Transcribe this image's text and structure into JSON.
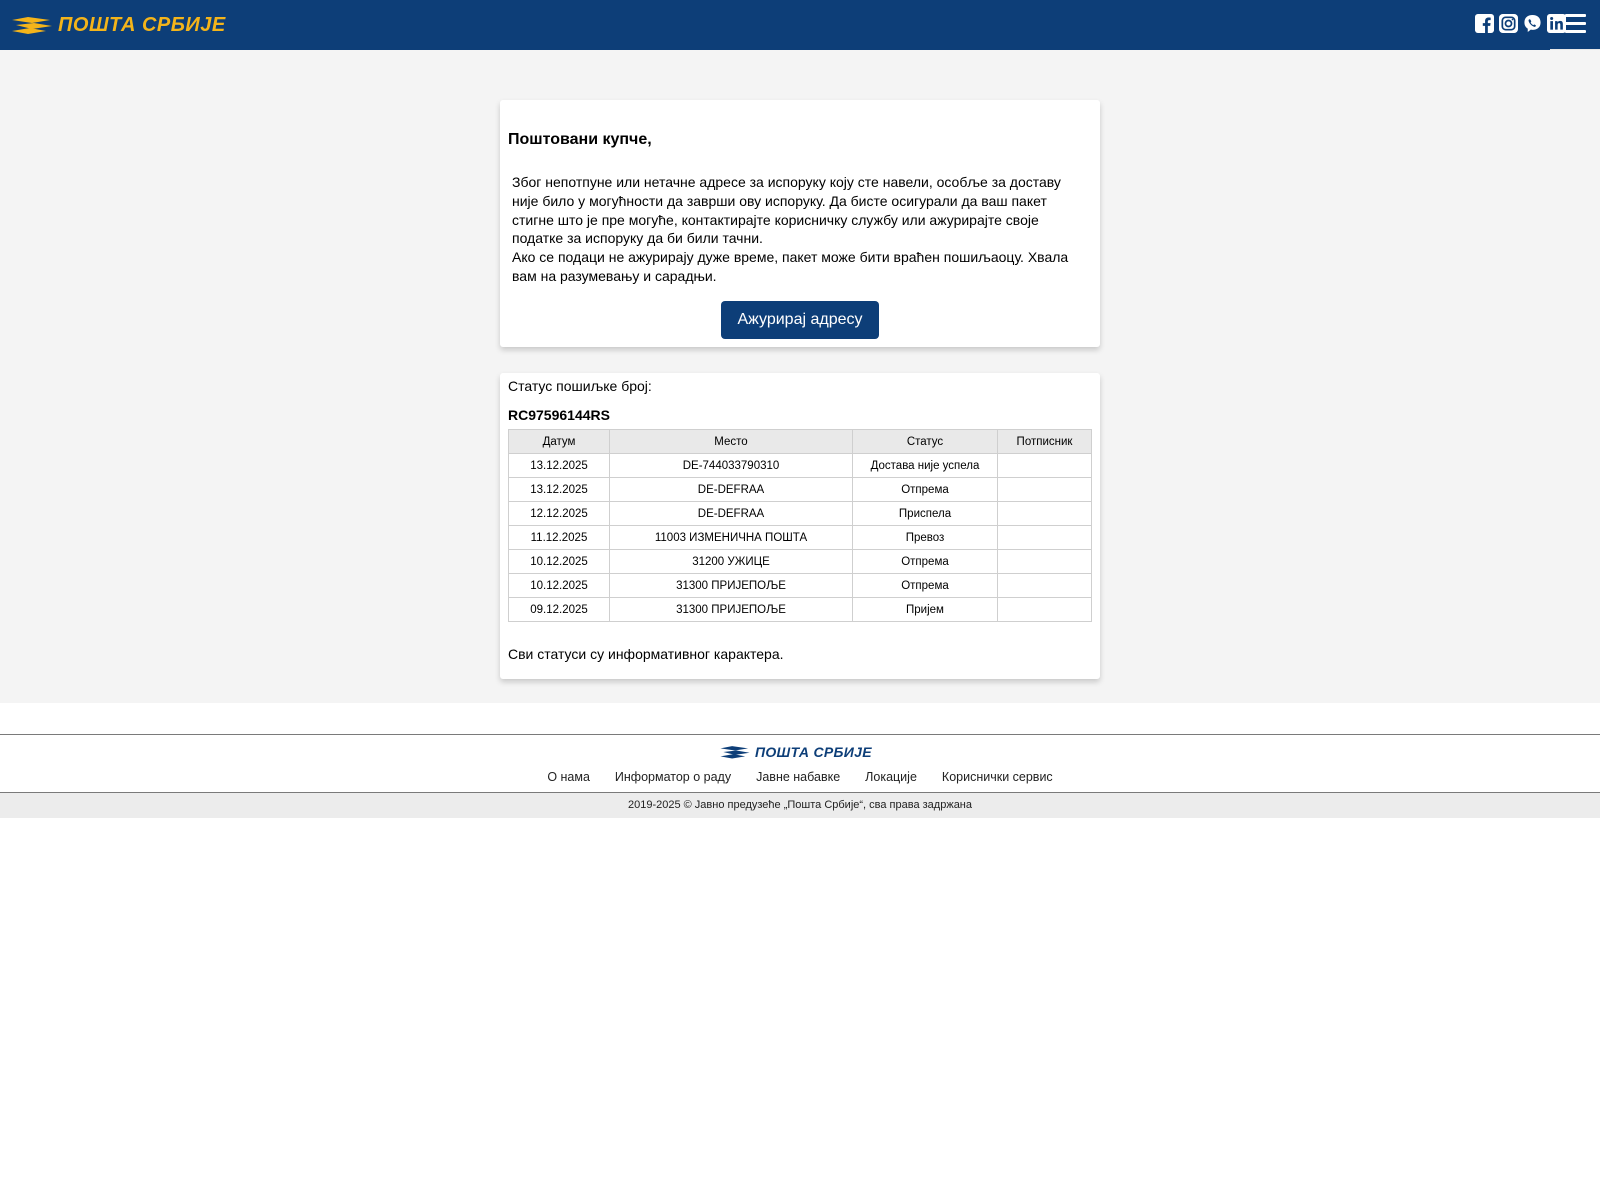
{
  "header": {
    "logo_text": "ПОШТА СРБИЈЕ",
    "social_icons": [
      "facebook-icon",
      "instagram-icon",
      "viber-icon",
      "linkedin-icon"
    ],
    "menu_icon": "hamburger-menu-icon",
    "bg_color": "#0d3e78",
    "logo_color": "#f4b41a"
  },
  "notice": {
    "greeting": "Поштовани купче,",
    "paragraph1": "Због непотпуне или нетачне адресе за испоруку коју сте навели, особље за доставу није било у могућности да заврши ову испоруку. Да бисте осигурали да ваш пакет стигне што је пре могуће, контактирајте корисничку службу или ажурирајте своје податке за испоруку да би били тачни.",
    "paragraph2": "Ако се подаци не ажурирају дуже време, пакет може бити враћен пошиљаоцу. Хвала вам на разумевању и сарадњи.",
    "button_label": "Ажурирај адресу"
  },
  "tracking": {
    "label": "Статус пошиљке број:",
    "number": "RC97596144RS",
    "columns": [
      "Датум",
      "Место",
      "Статус",
      "Потписник"
    ],
    "rows": [
      [
        "13.12.2025",
        "DE-744033790310",
        "Достава није успела",
        ""
      ],
      [
        "13.12.2025",
        "DE-DEFRAA",
        "Отпрема",
        ""
      ],
      [
        "12.12.2025",
        "DE-DEFRAA",
        "Приспела",
        ""
      ],
      [
        "11.12.2025",
        "11003 ИЗМЕНИЧНА ПОШТА",
        "Превоз",
        ""
      ],
      [
        "10.12.2025",
        "31200 УЖИЦЕ",
        "Отпрема",
        ""
      ],
      [
        "10.12.2025",
        "31300 ПРИЈЕПОЉЕ",
        "Отпрема",
        ""
      ],
      [
        "09.12.2025",
        "31300 ПРИЈЕПОЉЕ",
        "Пријем",
        ""
      ]
    ],
    "note": "Сви статуси су информативног карактера."
  },
  "footer": {
    "logo_text": "ПОШТА СРБИЈЕ",
    "links": [
      "О нама",
      "Информатор о раду",
      "Јавне набавке",
      "Локације",
      "Кориснички сервис"
    ],
    "copyright": "2019-2025 © Јавно предузеће „Пошта Србије“, сва права задржана"
  }
}
